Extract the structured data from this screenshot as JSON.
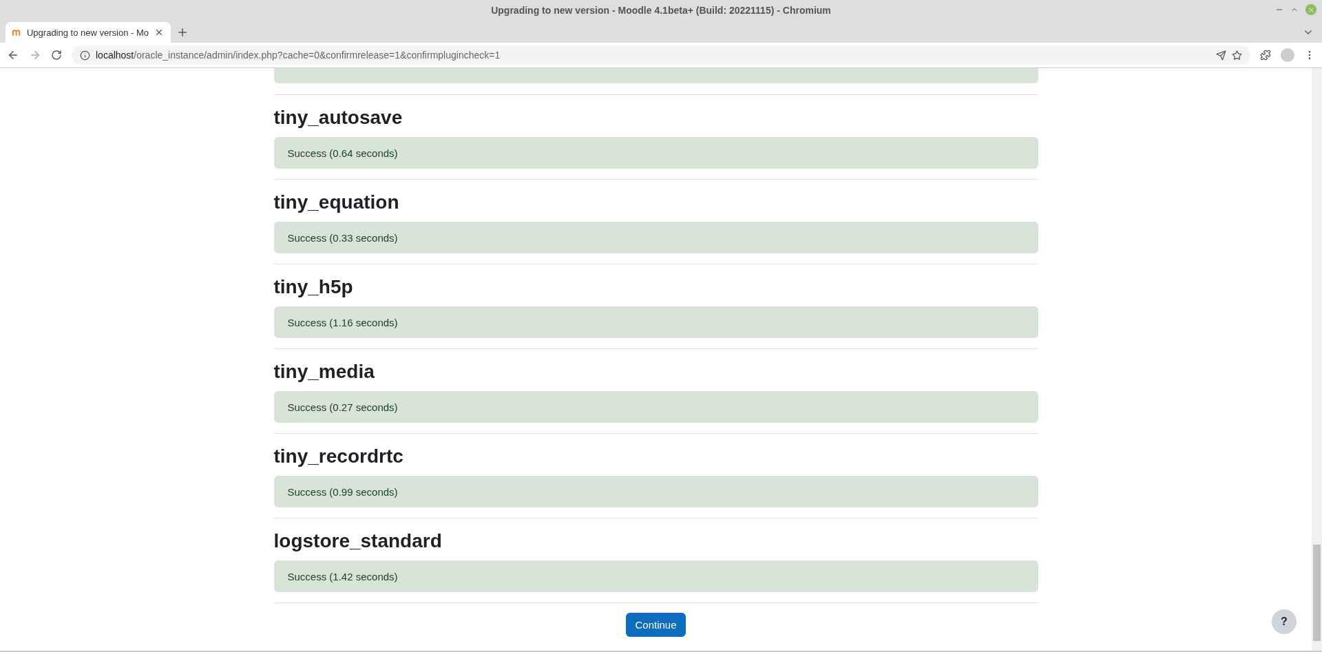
{
  "window": {
    "title": "Upgrading to new version - Moodle 4.1beta+ (Build: 20221115) - Chromium"
  },
  "tabs": [
    {
      "label": "Upgrading to new version - Mo",
      "selected": true
    }
  ],
  "address_bar": {
    "url_host": "localhost",
    "url_path": "/oracle_instance/admin/index.php?cache=0&confirmrelease=1&confirmplugincheck=1"
  },
  "sections": [
    {
      "heading": "tiny_autosave",
      "message": "Success (0.64 seconds)"
    },
    {
      "heading": "tiny_equation",
      "message": "Success (0.33 seconds)"
    },
    {
      "heading": "tiny_h5p",
      "message": "Success (1.16 seconds)"
    },
    {
      "heading": "tiny_media",
      "message": "Success (0.27 seconds)"
    },
    {
      "heading": "tiny_recordrtc",
      "message": "Success (0.99 seconds)"
    },
    {
      "heading": "logstore_standard",
      "message": "Success (1.42 seconds)"
    }
  ],
  "continue_button": "Continue",
  "help_button": "?"
}
